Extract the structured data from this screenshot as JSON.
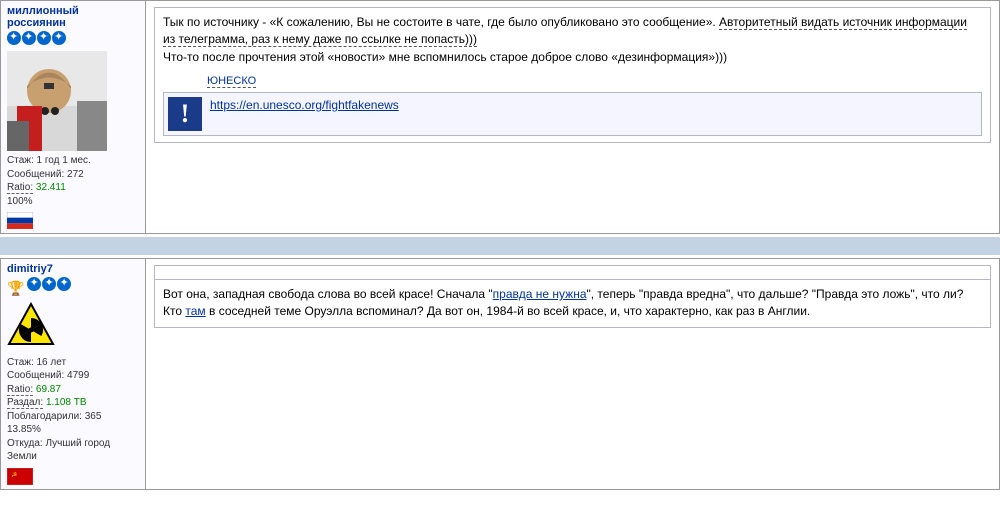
{
  "post1": {
    "username": "миллионный россиянин",
    "stars": 4,
    "stats": {
      "tenure_label": "Стаж:",
      "tenure": "1 год 1 мес.",
      "messages_label": "Сообщений:",
      "messages": "272",
      "ratio_label": "Ratio:",
      "ratio": "32.411",
      "pct": "100%"
    },
    "body_p1_a": "Тык по источнику - «К сожалению, Вы не состоите в чате, где было опубликовано это сообщение». ",
    "body_p1_b": "Авторитетный видать источник информации из телеграмма, раз к нему даже по ссылке не попасть)))",
    "body_p2": "Что-то после прочтения этой «новости» мне вспомнилось старое доброе слово «дезинформация»)))",
    "quote_title": "ЮНЕСКО",
    "quote_link": "https://en.unesco.org/fightfakenews"
  },
  "post2": {
    "username": "dimitriy7",
    "stars": 3,
    "trophy": true,
    "stats": {
      "tenure_label": "Стаж:",
      "tenure": "16 лет",
      "messages_label": "Сообщений:",
      "messages": "4799",
      "ratio_label": "Ratio:",
      "ratio": "69.87",
      "given_label": "Раздал:",
      "given": "1.108 ТВ",
      "thanked_label": "Поблагодарили:",
      "thanked": "365",
      "pct": "13.85%",
      "from_label": "Откуда:",
      "from": "Лучший город Земли"
    },
    "body_a": "Вот она, западная свобода слова во всей красе! Сначала \"",
    "body_link1": "правда не нужна",
    "body_b": "\", теперь \"правда вредна\", что дальше? \"Правда это ложь\", что ли? Кто ",
    "body_link2": "там",
    "body_c": " в соседней теме Оруэлла вспоминал? Да вот он, 1984-й во всей красе, и, что характерно, как раз в Англии."
  }
}
